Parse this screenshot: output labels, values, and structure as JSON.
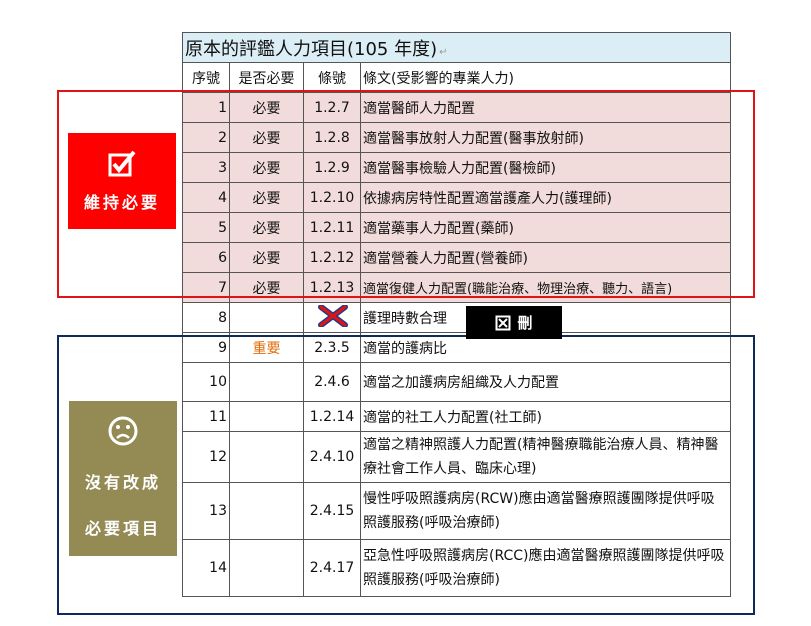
{
  "title": "原本的評鑑人力項目(105 年度)",
  "headers": {
    "seq": "序號",
    "required": "是否必要",
    "clause": "條號",
    "text": "條文(受影響的專業人力)"
  },
  "rows": [
    {
      "seq": "1",
      "required": "必要",
      "clause": "1.2.7",
      "text": "適當醫師人力配置"
    },
    {
      "seq": "2",
      "required": "必要",
      "clause": "1.2.8",
      "text": "適當醫事放射人力配置(醫事放射師)"
    },
    {
      "seq": "3",
      "required": "必要",
      "clause": "1.2.9",
      "text": "適當醫事檢驗人力配置(醫檢師)"
    },
    {
      "seq": "4",
      "required": "必要",
      "clause": "1.2.10",
      "text": "依據病房特性配置適當護產人力(護理師)"
    },
    {
      "seq": "5",
      "required": "必要",
      "clause": "1.2.11",
      "text": "適當藥事人力配置(藥師)"
    },
    {
      "seq": "6",
      "required": "必要",
      "clause": "1.2.12",
      "text": "適當營養人力配置(營養師)"
    },
    {
      "seq": "7",
      "required": "必要",
      "clause": "1.2.13",
      "text": "適當復健人力配置(職能治療、物理治療、聽力、語言)"
    },
    {
      "seq": "8",
      "required": "",
      "clause": "",
      "text": "護理時數合理"
    },
    {
      "seq": "9",
      "required": "重要",
      "clause": "2.3.5",
      "text": "適當的護病比"
    },
    {
      "seq": "10",
      "required": "",
      "clause": "2.4.6",
      "text": "適當之加護病房組織及人力配置"
    },
    {
      "seq": "11",
      "required": "",
      "clause": "1.2.14",
      "text": "適當的社工人力配置(社工師)"
    },
    {
      "seq": "12",
      "required": "",
      "clause": "2.4.10",
      "text": "適當之精神照護人力配置(精神醫療職能治療人員、精神醫療社會工作人員、臨床心理)"
    },
    {
      "seq": "13",
      "required": "",
      "clause": "2.4.15",
      "text": "慢性呼吸照護病房(RCW)應由適當醫療照護團隊提供呼吸照護服務(呼吸治療師)"
    },
    {
      "seq": "14",
      "required": "",
      "clause": "2.4.17",
      "text": "亞急性呼吸照護病房(RCC)應由適當醫療照護團隊提供呼吸照護服務(呼吸治療師)"
    }
  ],
  "labels": {
    "maintain": "維持必要",
    "not_changed_line1": "沒有改成",
    "not_changed_line2": "必要項目",
    "delete": "刪"
  },
  "icons": {
    "maintain": "checkbox-checked-icon",
    "not_changed": "sad-face-icon",
    "delete": "checkbox-cross-icon",
    "removed": "red-x-icon"
  },
  "colors": {
    "maintain_bg": "#ff0000",
    "not_changed_bg": "#948a54",
    "pink_rows": "#f2dcdb",
    "title_bg": "#dbeef5",
    "important": "#e36c09"
  }
}
